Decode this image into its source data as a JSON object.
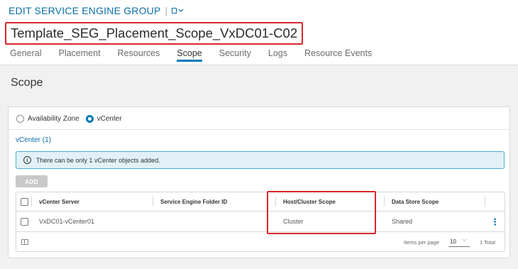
{
  "header": {
    "title": "EDIT SERVICE ENGINE GROUP",
    "separator": "|",
    "object_name": "Template_SEG_Placement_Scope_VxDC01-C02",
    "tabs": [
      {
        "label": "General",
        "active": false
      },
      {
        "label": "Placement",
        "active": false
      },
      {
        "label": "Resources",
        "active": false
      },
      {
        "label": "Scope",
        "active": true
      },
      {
        "label": "Security",
        "active": false
      },
      {
        "label": "Logs",
        "active": false
      },
      {
        "label": "Resource Events",
        "active": false
      }
    ]
  },
  "section": {
    "title": "Scope"
  },
  "scope_selector": {
    "options": [
      {
        "label": "Availability Zone",
        "selected": false
      },
      {
        "label": "vCenter",
        "selected": true
      }
    ]
  },
  "vcenter": {
    "heading": "vCenter (1)",
    "alert_text": "There can be only 1 vCenter objects added.",
    "add_label": "ADD",
    "columns": [
      "vCenter Server",
      "Service Engine Folder ID",
      "Host/Cluster Scope",
      "Data Store Scope"
    ],
    "rows": [
      {
        "vcenter_server": "VxDC01-vCenter01",
        "folder_id": "",
        "host_cluster_scope": "Cluster",
        "data_store_scope": "Shared"
      }
    ],
    "footer": {
      "items_per_page_label": "Items per page",
      "items_per_page_value": "10",
      "total": "1 Total"
    }
  },
  "colors": {
    "accent": "#0079b8",
    "title_blue": "#0b6ea8",
    "highlight_red": "#d9272e",
    "alert_bg": "#e1f1f6",
    "alert_border": "#49afd9"
  }
}
